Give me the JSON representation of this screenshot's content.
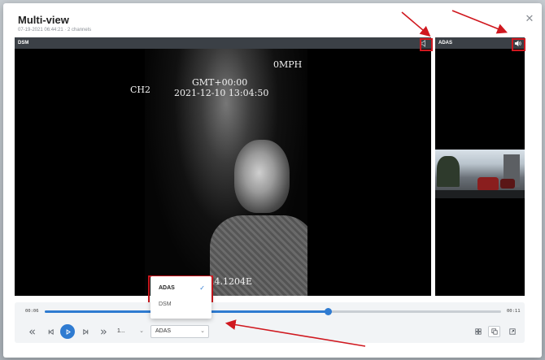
{
  "dialog": {
    "title": "Multi-view",
    "subtitle": "07-19-2021 06:44:21 · 2 channels",
    "close_icon": "close-icon"
  },
  "panes": [
    {
      "label": "DSM",
      "audio_icon": "speaker-muted-icon"
    },
    {
      "label": "ADAS",
      "audio_icon": "speaker-on-icon"
    }
  ],
  "dsm_overlay": {
    "speed": "0MPH",
    "channel": "CH2",
    "timezone": "GMT+00:00",
    "datetime": "2021-12-10 13:04:50",
    "coords": "35.4.1204E"
  },
  "playback": {
    "current_time": "00:06",
    "total_time": "00:11",
    "progress": 0.62
  },
  "controls": {
    "rewind_icon": "double-chevron-left-icon",
    "prev_icon": "skip-back-icon",
    "play_icon": "play-icon",
    "next_icon": "skip-forward-icon",
    "ff_icon": "double-chevron-right-icon",
    "speed_value": "1...",
    "channel_value": "ADAS"
  },
  "channel_dropdown": {
    "options": [
      "ADAS",
      "DSM"
    ],
    "selected": "ADAS"
  },
  "view_modes": {
    "grid_icon": "grid-icon",
    "pip_icon": "picture-in-picture-icon",
    "fullscreen_icon": "expand-icon"
  },
  "colors": {
    "accent": "#2f7bd1",
    "highlight": "#d0181f"
  }
}
